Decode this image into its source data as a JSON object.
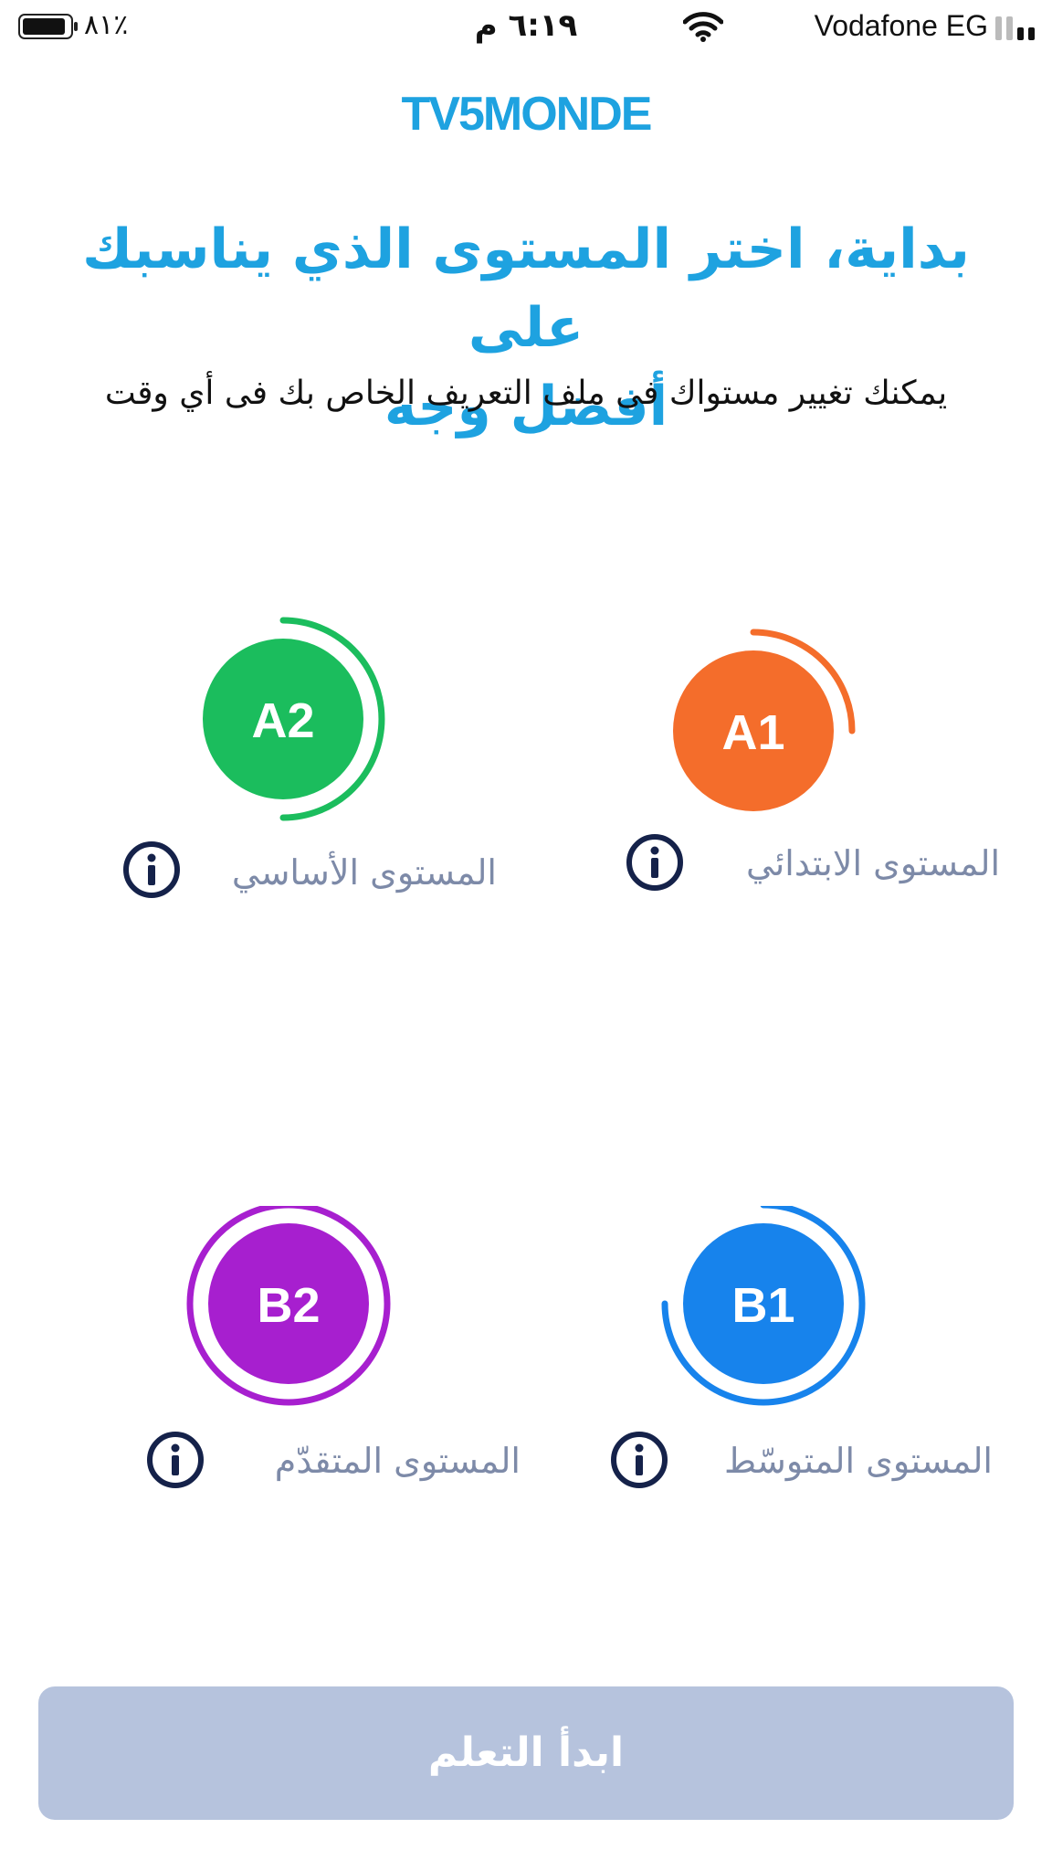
{
  "status_bar": {
    "carrier": "Vodafone EG",
    "time": "٦:١٩ م",
    "battery_percent": "٨١٪"
  },
  "logo": "TV5MONDE",
  "header": {
    "title_line1": "بداية، اختر المستوى الذي يناسبك على",
    "title_line2": "أفضل وجه",
    "subtitle": "يمكنك تغيير مستواك فى ملف التعريف الخاص بك فى أي وقت"
  },
  "levels": [
    {
      "code": "A1",
      "label": "المستوى الابتدائي",
      "color": "#f46d2b",
      "ring_fraction": 0.25
    },
    {
      "code": "A2",
      "label": "المستوى الأساسي",
      "color": "#1bbd5d",
      "ring_fraction": 0.5
    },
    {
      "code": "B1",
      "label": "المستوى المتوسّط",
      "color": "#1783ec",
      "ring_fraction": 0.75
    },
    {
      "code": "B2",
      "label": "المستوى المتقدّم",
      "color": "#a71fcf",
      "ring_fraction": 1.0
    }
  ],
  "icons": {
    "info": "info-icon",
    "wifi": "wifi-icon",
    "battery": "battery-icon",
    "signal": "signal-icon"
  },
  "colors": {
    "brand": "#1ea2e0",
    "button_disabled": "#b6c3dd",
    "label": "#7d8aa8",
    "info_icon": "#15224a"
  },
  "start_button": {
    "label": "ابدأ التعلم"
  }
}
